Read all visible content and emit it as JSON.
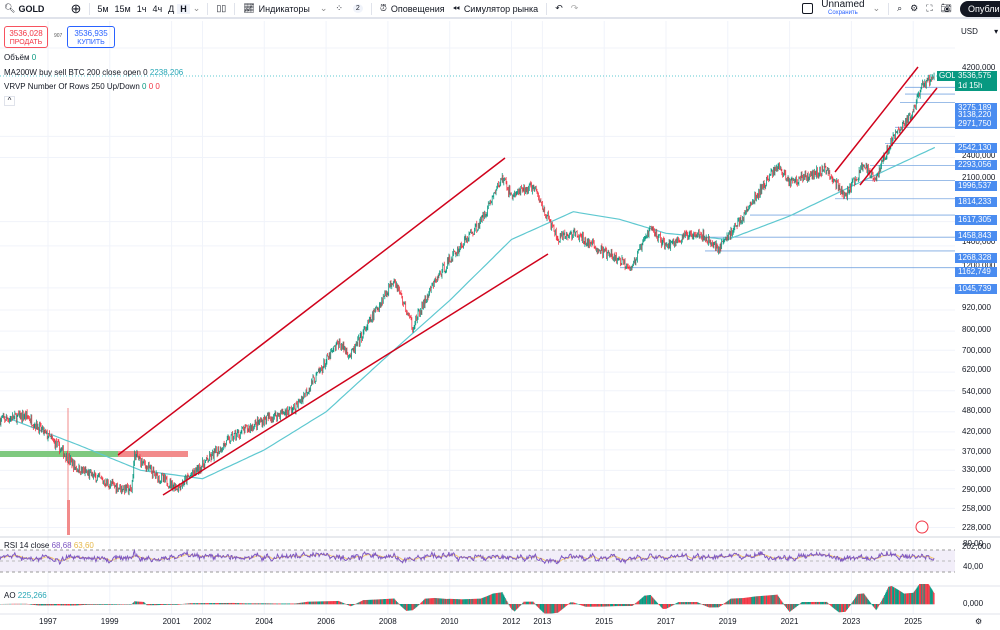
{
  "toolbar": {
    "symbol": "GOLD",
    "timeframes": [
      "5м",
      "15м",
      "1ч",
      "4ч",
      "Д",
      "Н"
    ],
    "active_timeframe": "Н",
    "indicators": "Индикаторы",
    "layouts_count": "2",
    "alerts": "Оповещения",
    "replay": "Симулятор рынка",
    "layout_name": "Unnamed",
    "save": "Сохранить",
    "publish": "Опубликовать"
  },
  "trade": {
    "sell_price": "3536,028",
    "sell_label": "ПРОДАТЬ",
    "spread": "907",
    "buy_price": "3536,935",
    "buy_label": "КУПИТЬ"
  },
  "legend": {
    "volume": "Объём",
    "volume_value": "0",
    "ma": "MA200W buy sell BTC 200 close open 0",
    "ma_value": "2238,206",
    "vrvp": "VRVP Number Of Rows 250 Up/Down",
    "vrvp_v1": "0",
    "vrvp_v2": "0",
    "vrvp_v3": "0",
    "rsi": "RSI 14 close",
    "rsi_value": "68,68",
    "rsi_ma": "63,60",
    "ao": "AO",
    "ao_value": "225,266"
  },
  "price_axis": {
    "currency": "USD",
    "ticks": [
      "4200,000",
      "2400,000",
      "2100,000",
      "1400,000",
      "1200,000",
      "920,000",
      "800,000",
      "700,000",
      "620,000",
      "540,000",
      "480,000",
      "420,000",
      "370,000",
      "330,000",
      "290,000",
      "258,000",
      "228,000",
      "202,000"
    ],
    "tick_values": [
      4200,
      2400,
      2100,
      1400,
      1200,
      920,
      800,
      700,
      620,
      540,
      480,
      420,
      370,
      330,
      290,
      258,
      228,
      202
    ],
    "last_symbol": "GOLD",
    "last_price": "3536,575",
    "countdown": "1d 15h",
    "levels": [
      "3275,189",
      "3138,220",
      "2971,750",
      "2542,130",
      "2293,056",
      "1996,537",
      "1814,233",
      "1617,305",
      "1458,843",
      "1268,328",
      "1162,749",
      "1045,739"
    ],
    "rsi_ticks": [
      "80,00",
      "40,00"
    ],
    "ao_tick": "0,000"
  },
  "time_axis": [
    "1997",
    "1999",
    "2001",
    "2002",
    "2004",
    "2006",
    "2008",
    "2010",
    "2012",
    "2013",
    "2015",
    "2017",
    "2019",
    "2021",
    "2023",
    "2025"
  ],
  "colors": {
    "up": "#089981",
    "down": "#f23645",
    "ma": "#5ec8d0",
    "trend": "#d0021b",
    "level_bg": "#4a8cf0",
    "rsi": "#7e57c2",
    "rsi_ma": "#f5c96b"
  },
  "chart_data": {
    "type": "candlestick",
    "scale": "log",
    "symbol": "GOLD",
    "price_anchors": [
      [
        1995.5,
        400
      ],
      [
        1996.3,
        410
      ],
      [
        1997.3,
        340
      ],
      [
        1997.9,
        295
      ],
      [
        1999.0,
        265
      ],
      [
        1999.7,
        255
      ],
      [
        1999.8,
        320
      ],
      [
        2000.5,
        280
      ],
      [
        2001.2,
        260
      ],
      [
        2002,
        300
      ],
      [
        2003,
        360
      ],
      [
        2004,
        400
      ],
      [
        2005,
        430
      ],
      [
        2006.4,
        650
      ],
      [
        2006.8,
        600
      ],
      [
        2008.2,
        980
      ],
      [
        2008.8,
        720
      ],
      [
        2009.5,
        950
      ],
      [
        2010,
        1100
      ],
      [
        2011,
        1400
      ],
      [
        2011.7,
        1850
      ],
      [
        2012,
        1650
      ],
      [
        2012.7,
        1750
      ],
      [
        2013.5,
        1250
      ],
      [
        2014,
        1300
      ],
      [
        2015,
        1150
      ],
      [
        2015.9,
        1050
      ],
      [
        2016.5,
        1350
      ],
      [
        2017,
        1200
      ],
      [
        2018,
        1320
      ],
      [
        2018.7,
        1180
      ],
      [
        2019.5,
        1450
      ],
      [
        2020.6,
        2000
      ],
      [
        2021,
        1800
      ],
      [
        2022.2,
        1950
      ],
      [
        2022.8,
        1640
      ],
      [
        2023.4,
        2000
      ],
      [
        2023.8,
        1850
      ],
      [
        2024.3,
        2350
      ],
      [
        2025,
        2800
      ],
      [
        2025.3,
        3300
      ],
      [
        2025.7,
        3536.575
      ]
    ],
    "ma200w": [
      [
        1995.5,
        410
      ],
      [
        1998,
        340
      ],
      [
        2000,
        290
      ],
      [
        2002,
        275
      ],
      [
        2004,
        330
      ],
      [
        2006,
        420
      ],
      [
        2008,
        600
      ],
      [
        2010,
        850
      ],
      [
        2012,
        1250
      ],
      [
        2014,
        1490
      ],
      [
        2015.5,
        1420
      ],
      [
        2017,
        1300
      ],
      [
        2019,
        1250
      ],
      [
        2021,
        1450
      ],
      [
        2023,
        1750
      ],
      [
        2025.7,
        2238.206
      ]
    ],
    "levels": [
      3275.189,
      3138.22,
      2971.75,
      2542.13,
      2293.056,
      1996.537,
      1814.233,
      1617.305,
      1458.843,
      1268.328,
      1162.749,
      1045.739
    ]
  }
}
